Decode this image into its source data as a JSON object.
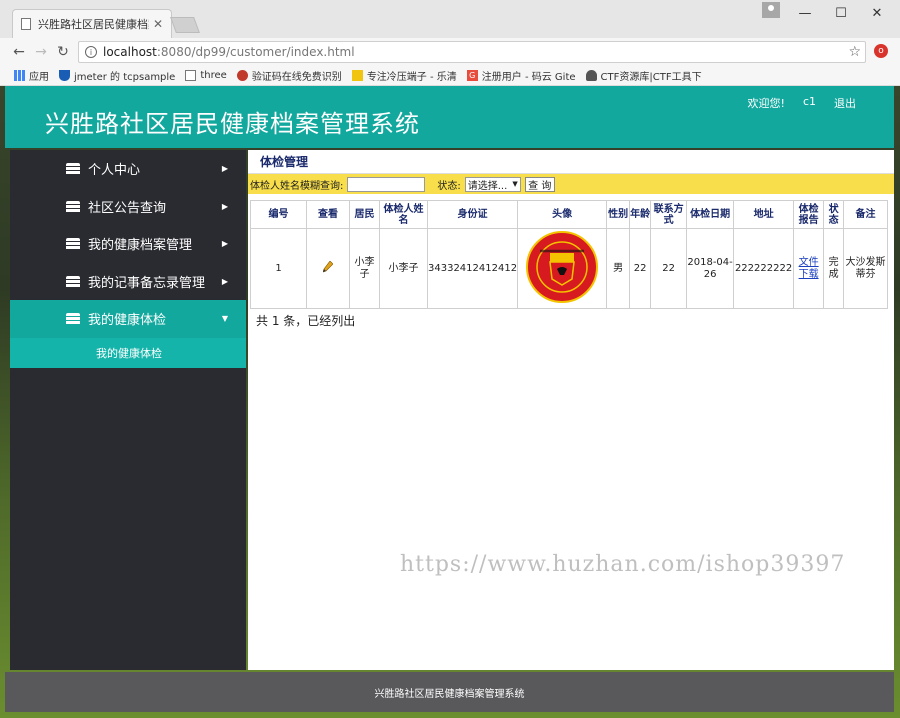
{
  "browser": {
    "tab_title": "兴胜路社区居民健康档案",
    "tab_close": "✕",
    "url_host": "localhost",
    "url_path": ":8080/dp99/customer/index.html",
    "window_minimize": "—",
    "window_maximize": "☐",
    "window_close": "✕",
    "bookmarks": [
      {
        "icon": "apps-icon",
        "label": "应用"
      },
      {
        "icon": "shield-icon",
        "label": "jmeter 的 tcpsample"
      },
      {
        "icon": "page-icon",
        "label": "three"
      },
      {
        "icon": "captcha-icon",
        "label": "验证码在线免费识别"
      },
      {
        "icon": "folder-icon",
        "label": "专注冷压端子 - 乐清"
      },
      {
        "icon": "gitee-icon",
        "label": "注册用户 - 码云 Gite"
      },
      {
        "icon": "person-icon",
        "label": "CTF资源库|CTF工具下"
      }
    ]
  },
  "header": {
    "title": "兴胜路社区居民健康档案管理系统",
    "welcome": "欢迎您!",
    "username": "c1",
    "logout": "退出"
  },
  "sidebar": {
    "items": [
      {
        "label": "个人中心",
        "arrow": "▶"
      },
      {
        "label": "社区公告查询",
        "arrow": "▶"
      },
      {
        "label": "我的健康档案管理",
        "arrow": "▶"
      },
      {
        "label": "我的记事备忘录管理",
        "arrow": "▶"
      },
      {
        "label": "我的健康体检",
        "arrow": "▼"
      }
    ],
    "submenu": "我的健康体检"
  },
  "main": {
    "panel_title": "体检管理",
    "search_label": "体检人姓名模糊查询:",
    "status_label": "状态:",
    "status_value": "请选择...",
    "status_caret": "▼",
    "search_button": "查 询",
    "columns": [
      "编号",
      "查看",
      "居民",
      "体检人姓名",
      "身份证",
      "头像",
      "性别",
      "年龄",
      "联系方式",
      "体检日期",
      "地址",
      "体检报告",
      "状态",
      "备注"
    ],
    "row": {
      "id": "1",
      "resident": "小李子",
      "name": "小李子",
      "id_card": "34332412412412",
      "avatar_text": "MANCHESTER UNITED",
      "gender": "男",
      "age": "22",
      "contact": "22",
      "date": "2018-04-26",
      "address": "222222222",
      "report": "文件下载",
      "status": "完成",
      "remark": "大沙发斯蒂芬"
    },
    "summary": "共 1 条，已经列出"
  },
  "watermark": "https://www.huzhan.com/ishop39397",
  "footer": "兴胜路社区居民健康档案管理系统",
  "colors": {
    "accent": "#13a89e",
    "sidebar": "#2a2b30",
    "search_bar": "#f7de4a",
    "footer": "#59595c"
  }
}
